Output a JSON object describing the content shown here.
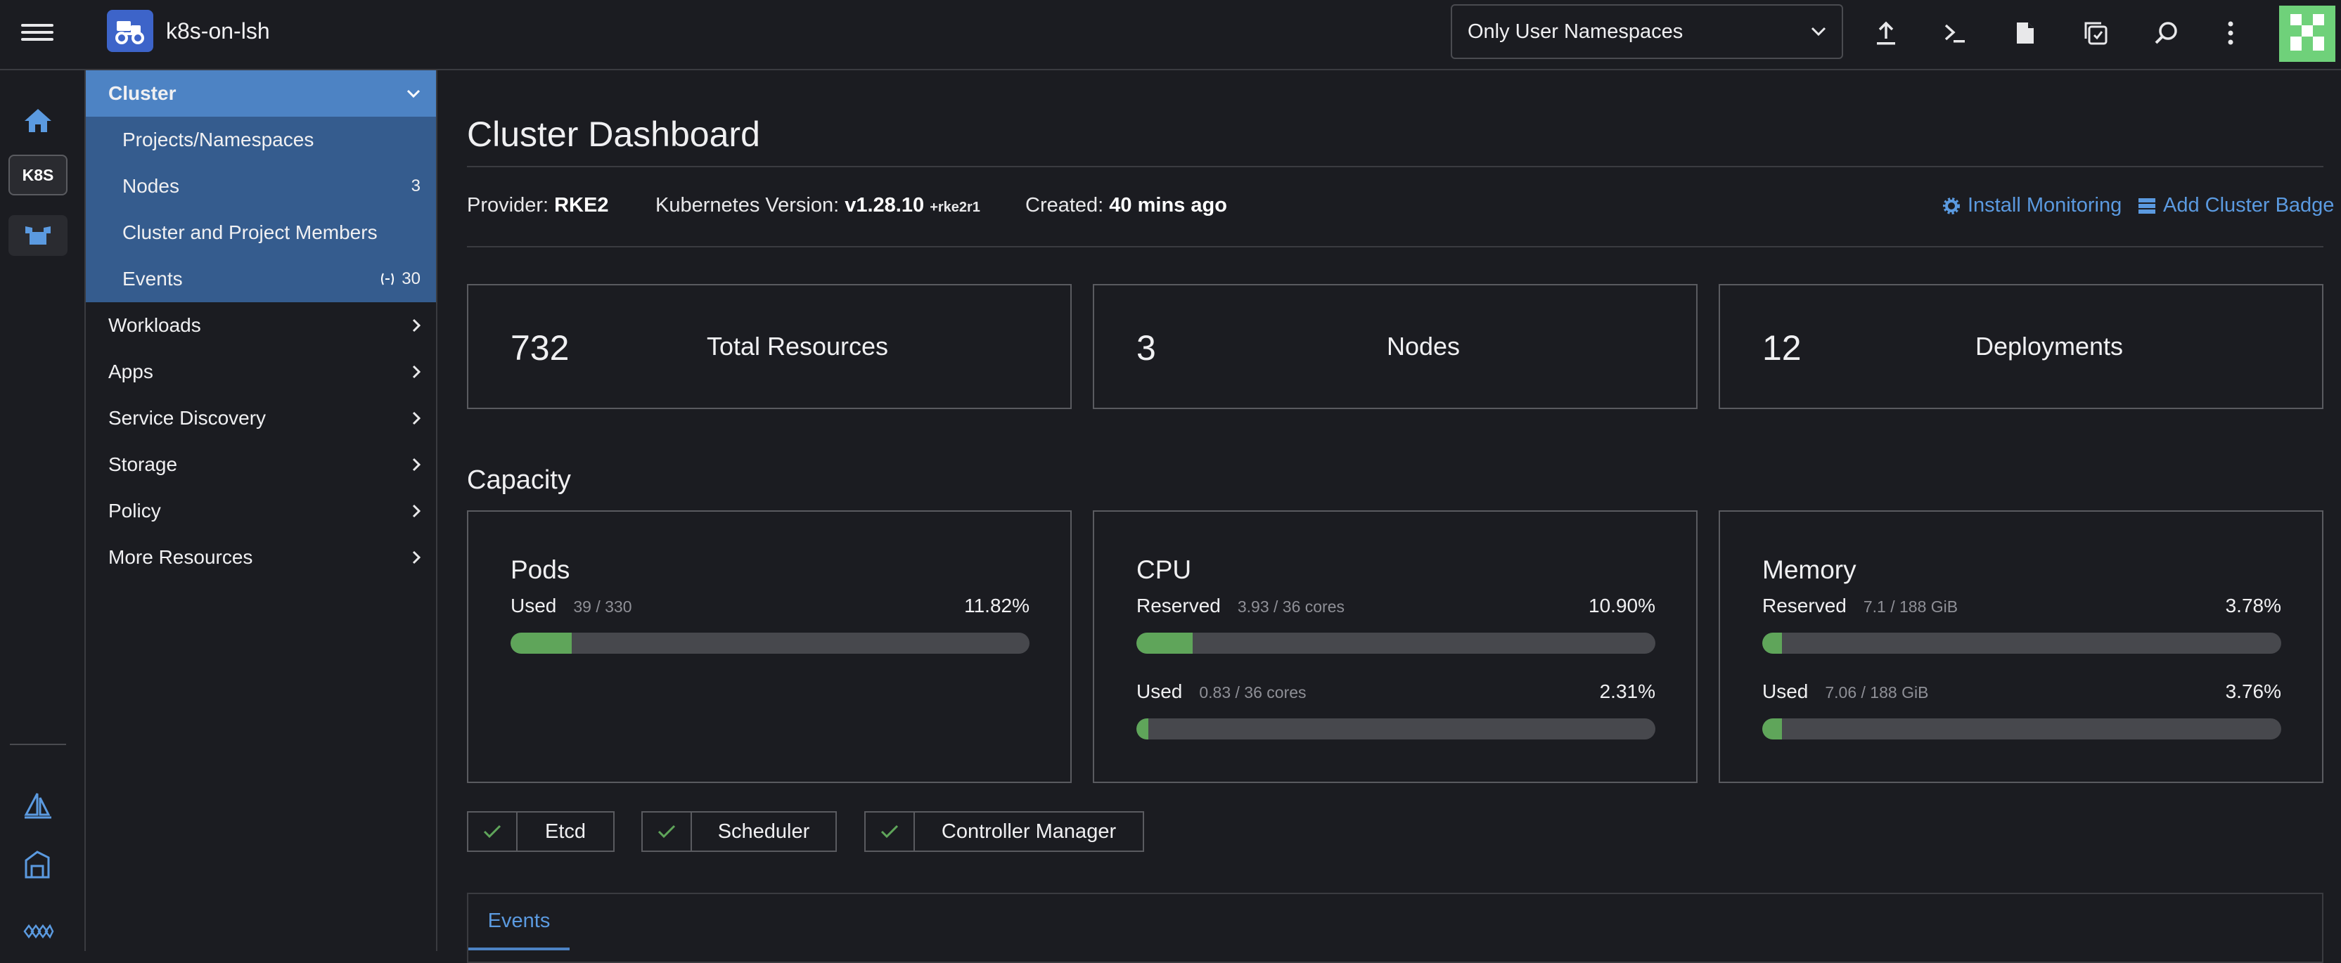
{
  "header": {
    "cluster_name": "k8s-on-lsh",
    "namespace_filter": "Only User Namespaces",
    "icons": [
      "upload-icon",
      "terminal-icon",
      "file-icon",
      "copy-config-icon",
      "search-icon",
      "more-vertical-icon"
    ]
  },
  "rail": {
    "k8s_label": "K8S"
  },
  "sidebar": {
    "cluster": {
      "label": "Cluster",
      "items": [
        {
          "label": "Projects/Namespaces",
          "count": ""
        },
        {
          "label": "Nodes",
          "count": "3"
        },
        {
          "label": "Cluster and Project Members",
          "count": ""
        },
        {
          "label": "Events",
          "count": "30"
        }
      ]
    },
    "groups": [
      {
        "label": "Workloads"
      },
      {
        "label": "Apps"
      },
      {
        "label": "Service Discovery"
      },
      {
        "label": "Storage"
      },
      {
        "label": "Policy"
      },
      {
        "label": "More Resources"
      }
    ]
  },
  "main": {
    "title": "Cluster Dashboard",
    "meta": {
      "provider_label": "Provider:",
      "provider_value": "RKE2",
      "k8s_label": "Kubernetes Version:",
      "k8s_value": "v1.28.10",
      "k8s_suffix": "+rke2r1",
      "created_label": "Created:",
      "created_value": "40 mins ago"
    },
    "links": {
      "install_monitoring": "Install Monitoring",
      "add_badge": "Add Cluster Badge"
    },
    "stats": [
      {
        "value": "732",
        "label": "Total Resources"
      },
      {
        "value": "3",
        "label": "Nodes"
      },
      {
        "value": "12",
        "label": "Deployments"
      }
    ],
    "capacity_title": "Capacity",
    "capacity": [
      {
        "title": "Pods",
        "meters": [
          {
            "label": "Used",
            "detail": "39 / 330",
            "percent": "11.82%",
            "fraction": 0.1182
          }
        ]
      },
      {
        "title": "CPU",
        "meters": [
          {
            "label": "Reserved",
            "detail": "3.93 / 36 cores",
            "percent": "10.90%",
            "fraction": 0.109
          },
          {
            "label": "Used",
            "detail": "0.83 / 36 cores",
            "percent": "2.31%",
            "fraction": 0.0231
          }
        ]
      },
      {
        "title": "Memory",
        "meters": [
          {
            "label": "Reserved",
            "detail": "7.1 / 188 GiB",
            "percent": "3.78%",
            "fraction": 0.0378
          },
          {
            "label": "Used",
            "detail": "7.06 / 188 GiB",
            "percent": "3.76%",
            "fraction": 0.0376
          }
        ]
      }
    ],
    "components": [
      "Etcd",
      "Scheduler",
      "Controller Manager"
    ],
    "events_tab": "Events"
  },
  "colors": {
    "accent": "#4d83c4",
    "link": "#5b9ae0",
    "bar_fill": "#5fa55a",
    "bar_track": "#47484d",
    "status_ok": "#5fa55a"
  }
}
